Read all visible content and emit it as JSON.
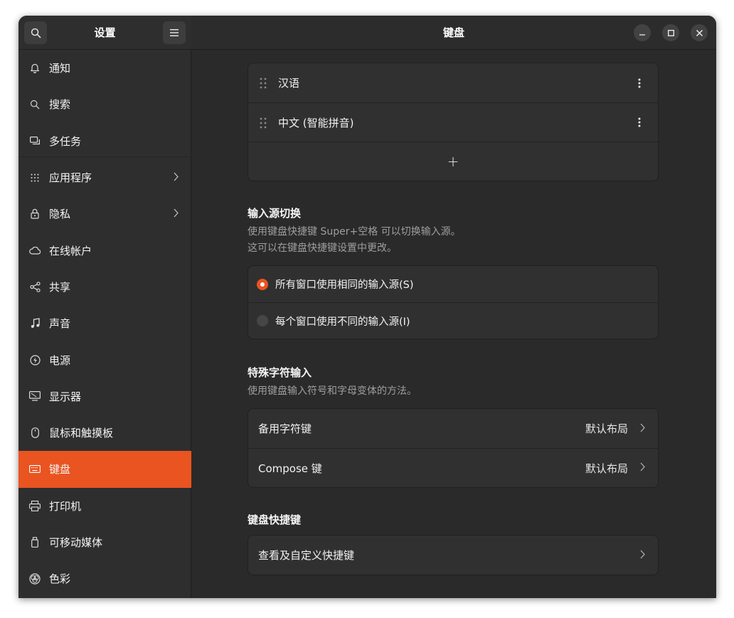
{
  "sidebar": {
    "title": "设置",
    "items": [
      {
        "label": "通知"
      },
      {
        "label": "搜索"
      },
      {
        "label": "多任务"
      },
      {
        "label": "应用程序"
      },
      {
        "label": "隐私"
      },
      {
        "label": "在线帐户"
      },
      {
        "label": "共享"
      },
      {
        "label": "声音"
      },
      {
        "label": "电源"
      },
      {
        "label": "显示器"
      },
      {
        "label": "鼠标和触摸板"
      },
      {
        "label": "键盘"
      },
      {
        "label": "打印机"
      },
      {
        "label": "可移动媒体"
      },
      {
        "label": "色彩"
      }
    ]
  },
  "header": {
    "title": "键盘"
  },
  "input_sources": {
    "items": [
      {
        "label": "汉语"
      },
      {
        "label": "中文 (智能拼音)"
      }
    ],
    "add_label": "+"
  },
  "switching": {
    "title": "输入源切换",
    "desc1": "使用键盘快捷键 Super+空格 可以切换输入源。",
    "desc2": "这可以在键盘快捷键设置中更改。",
    "option_same": "所有窗口使用相同的输入源(S)",
    "option_diff": "每个窗口使用不同的输入源(I)"
  },
  "special": {
    "title": "特殊字符输入",
    "desc": "使用键盘输入符号和字母变体的方法。",
    "alt_key_label": "备用字符键",
    "alt_key_value": "默认布局",
    "compose_label": "Compose 键",
    "compose_value": "默认布局"
  },
  "shortcuts": {
    "title": "键盘快捷键",
    "view_label": "查看及自定义快捷键"
  },
  "colors": {
    "accent": "#e95420"
  }
}
